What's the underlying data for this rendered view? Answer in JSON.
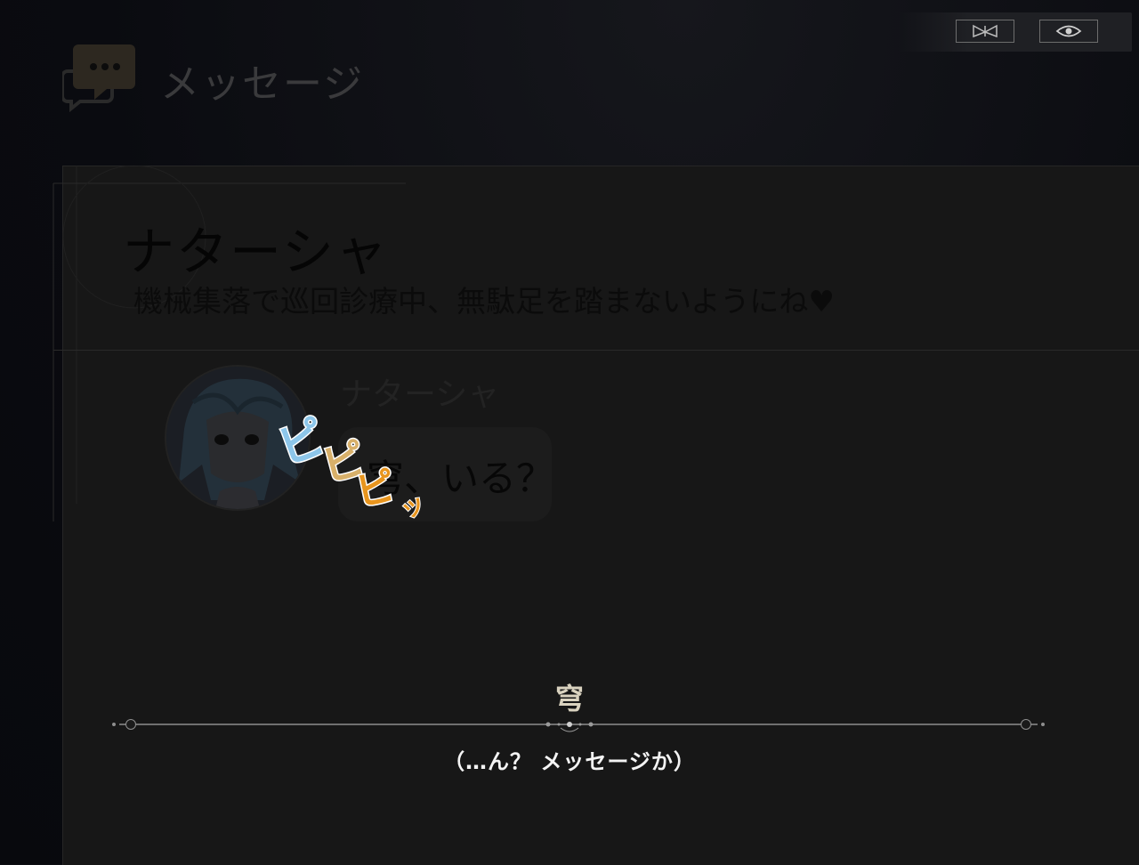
{
  "header": {
    "title": "メッセージ",
    "icon": "chat-bubbles-icon"
  },
  "topbar": {
    "skip_icon": "skip-icon",
    "hide_icon": "eye-icon"
  },
  "contact": {
    "name": "ナターシャ",
    "status": "機械集落で巡回診療中、無駄足を踏まないようにね♥"
  },
  "message": {
    "sender": "ナターシャ",
    "text": "穹、いる？",
    "sound_effect": "ピピピッ"
  },
  "dialogue": {
    "speaker": "穹",
    "text": "（…ん？ メッセージか）"
  },
  "colors": {
    "accent": "#d9d2bf",
    "sfx_blue": "#5fb2e6",
    "sfx_orange": "#e8951e"
  }
}
